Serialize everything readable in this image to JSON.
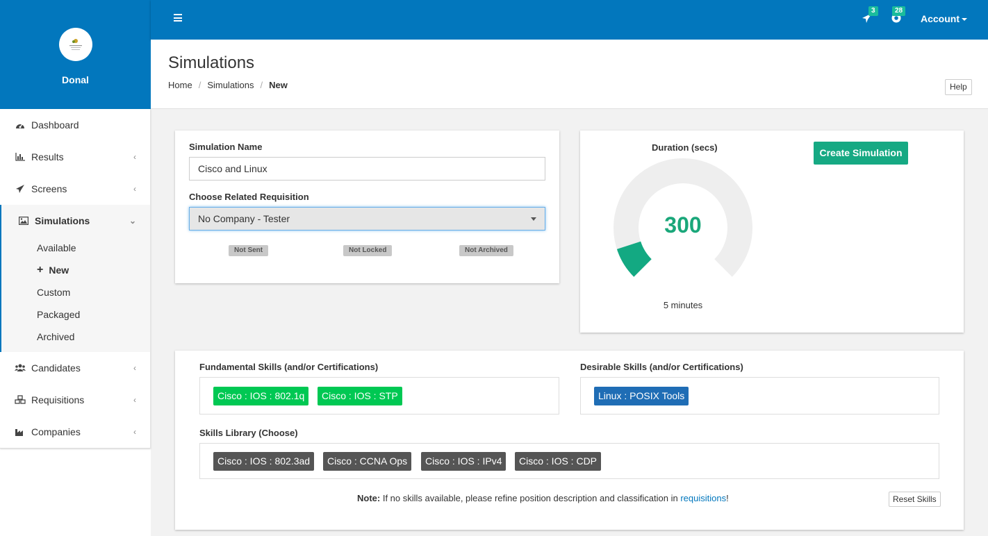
{
  "sidebar": {
    "username": "Donal",
    "items": [
      {
        "label": "Dashboard"
      },
      {
        "label": "Results"
      },
      {
        "label": "Screens"
      },
      {
        "label": "Simulations"
      },
      {
        "label": "Candidates"
      },
      {
        "label": "Requisitions"
      },
      {
        "label": "Companies"
      }
    ],
    "simulations_sub": [
      "Available",
      "New",
      "Custom",
      "Packaged",
      "Archived"
    ]
  },
  "topbar": {
    "notif_sent_count": "3",
    "notif_support_count": "28",
    "account_label": "Account"
  },
  "header": {
    "title": "Simulations",
    "breadcrumb": [
      "Home",
      "Simulations",
      "New"
    ],
    "help_label": "Help"
  },
  "form": {
    "name_label": "Simulation Name",
    "name_value": "Cisco and Linux",
    "requisition_label": "Choose Related Requisition",
    "requisition_value": "No Company - Tester",
    "statuses": [
      "Not Sent",
      "Not Locked",
      "Not Archived"
    ]
  },
  "duration": {
    "title": "Duration (secs)",
    "value": "300",
    "fraction": 0.1,
    "minutes_label": "5 minutes",
    "create_label": "Create Simulation",
    "colors": {
      "fill": "#13a982",
      "track": "#eeeeee"
    }
  },
  "skills": {
    "fundamental_title": "Fundamental Skills (and/or Certifications)",
    "fundamental": [
      "Cisco : IOS : 802.1q",
      "Cisco : IOS : STP"
    ],
    "desirable_title": "Desirable Skills (and/or Certifications)",
    "desirable": [
      "Linux : POSIX Tools"
    ],
    "library_title": "Skills Library (Choose)",
    "library": [
      "Cisco : IOS : 802.3ad",
      "Cisco : CCNA Ops",
      "Cisco : IOS : IPv4",
      "Cisco : IOS : CDP"
    ],
    "note_prefix": "Note:",
    "note_text": " If no skills available, please refine position description and classification in ",
    "note_link": "requisitions",
    "note_suffix": "!",
    "reset_label": "Reset Skills"
  },
  "colors": {
    "brand": "#0277bd",
    "accent": "#16a983",
    "skill_green": "#00c853",
    "skill_blue": "#1f6db5",
    "skill_dark": "#555555"
  }
}
